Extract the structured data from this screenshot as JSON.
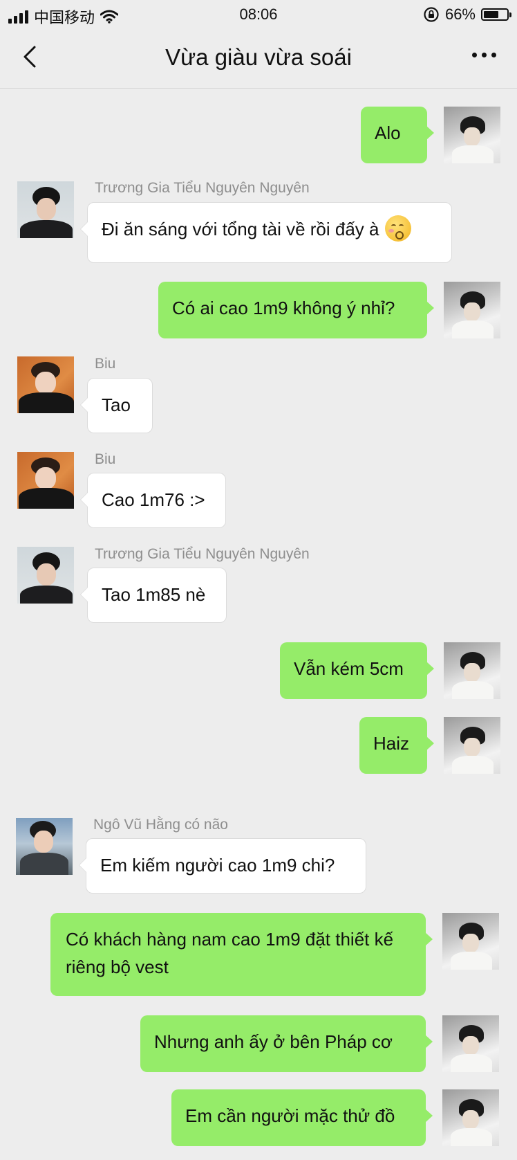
{
  "status_bar": {
    "carrier": "中国移动",
    "time": "08:06",
    "battery_percent_text": "66%",
    "battery_level": 0.66,
    "icons": [
      "signal-icon",
      "wifi-icon",
      "rotation-lock-icon",
      "battery-icon"
    ]
  },
  "nav": {
    "title": "Vừa giàu vừa soái",
    "back_icon": "chevron-left-icon",
    "more_icon": "more-dots-icon"
  },
  "colors": {
    "background": "#ededed",
    "outgoing_bubble": "#95ec69",
    "incoming_bubble": "#ffffff",
    "sender_name": "#8e8e8e"
  },
  "messages": [
    {
      "direction": "out",
      "text": "Alo"
    },
    {
      "direction": "in",
      "sender": "Trương Gia Tiểu Nguyên Nguyên",
      "text": "Đi ăn sáng với tổng tài về rồi đấy à",
      "emoji": "blushing-face-emoji"
    },
    {
      "direction": "out",
      "text": "Có ai cao 1m9 không ý nhỉ?"
    },
    {
      "direction": "in",
      "sender": "Biu",
      "text": "Tao"
    },
    {
      "direction": "in",
      "sender": "Biu",
      "text": "Cao 1m76 :>"
    },
    {
      "direction": "in",
      "sender": "Trương Gia Tiểu Nguyên Nguyên",
      "text": "Tao 1m85 nè"
    },
    {
      "direction": "out",
      "text": "Vẫn kém 5cm"
    },
    {
      "direction": "out",
      "text": "Haiz"
    },
    {
      "direction": "in",
      "sender": "Ngô Vũ Hằng có não",
      "text": "Em kiếm người cao 1m9 chi?"
    },
    {
      "direction": "out",
      "text": "Có khách hàng nam cao 1m9 đặt thiết kế riêng bộ vest"
    },
    {
      "direction": "out",
      "text": "Nhưng anh ấy ở bên Pháp cơ"
    },
    {
      "direction": "out",
      "text": "Em cần người mặc thử đồ"
    }
  ]
}
